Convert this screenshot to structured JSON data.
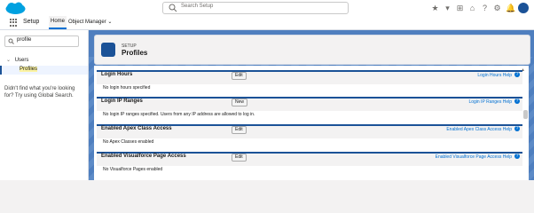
{
  "header": {
    "search_placeholder": "Search Setup",
    "icons": [
      "star-icon",
      "dropdown-icon",
      "add-icon",
      "trailhead-icon",
      "help-icon",
      "gear-icon",
      "bell-icon",
      "avatar"
    ]
  },
  "nav": {
    "app_name": "Setup",
    "tabs": [
      {
        "label": "Home"
      },
      {
        "label": "Object Manager"
      }
    ]
  },
  "sidebar": {
    "quickfind_value": "profile",
    "group_label": "Users",
    "selected_item": "Profiles",
    "hint": "Didn't find what you're looking for? Try using Global Search."
  },
  "page": {
    "subtitle": "SETUP",
    "title": "Profiles"
  },
  "sections": [
    {
      "title": "Login Hours",
      "button": "Edit",
      "help": "Login Hours Help",
      "body": "No login hours specified"
    },
    {
      "title": "Login IP Ranges",
      "button": "New",
      "help": "Login IP Ranges Help",
      "body": "No login IP ranges specified. Users from any IP address are allowed to log in."
    },
    {
      "title": "Enabled Apex Class Access",
      "button": "Edit",
      "help": "Enabled Apex Class Access Help",
      "body": "No Apex Classes enabled"
    },
    {
      "title": "Enabled Visualforce Page Access",
      "button": "Edit",
      "help": "Enabled Visualforce Page Access Help",
      "body": "No Visualforce Pages enabled"
    }
  ],
  "colors": {
    "brand": "#1b5297",
    "link": "#0070d2",
    "background": "#4f7fbf"
  }
}
